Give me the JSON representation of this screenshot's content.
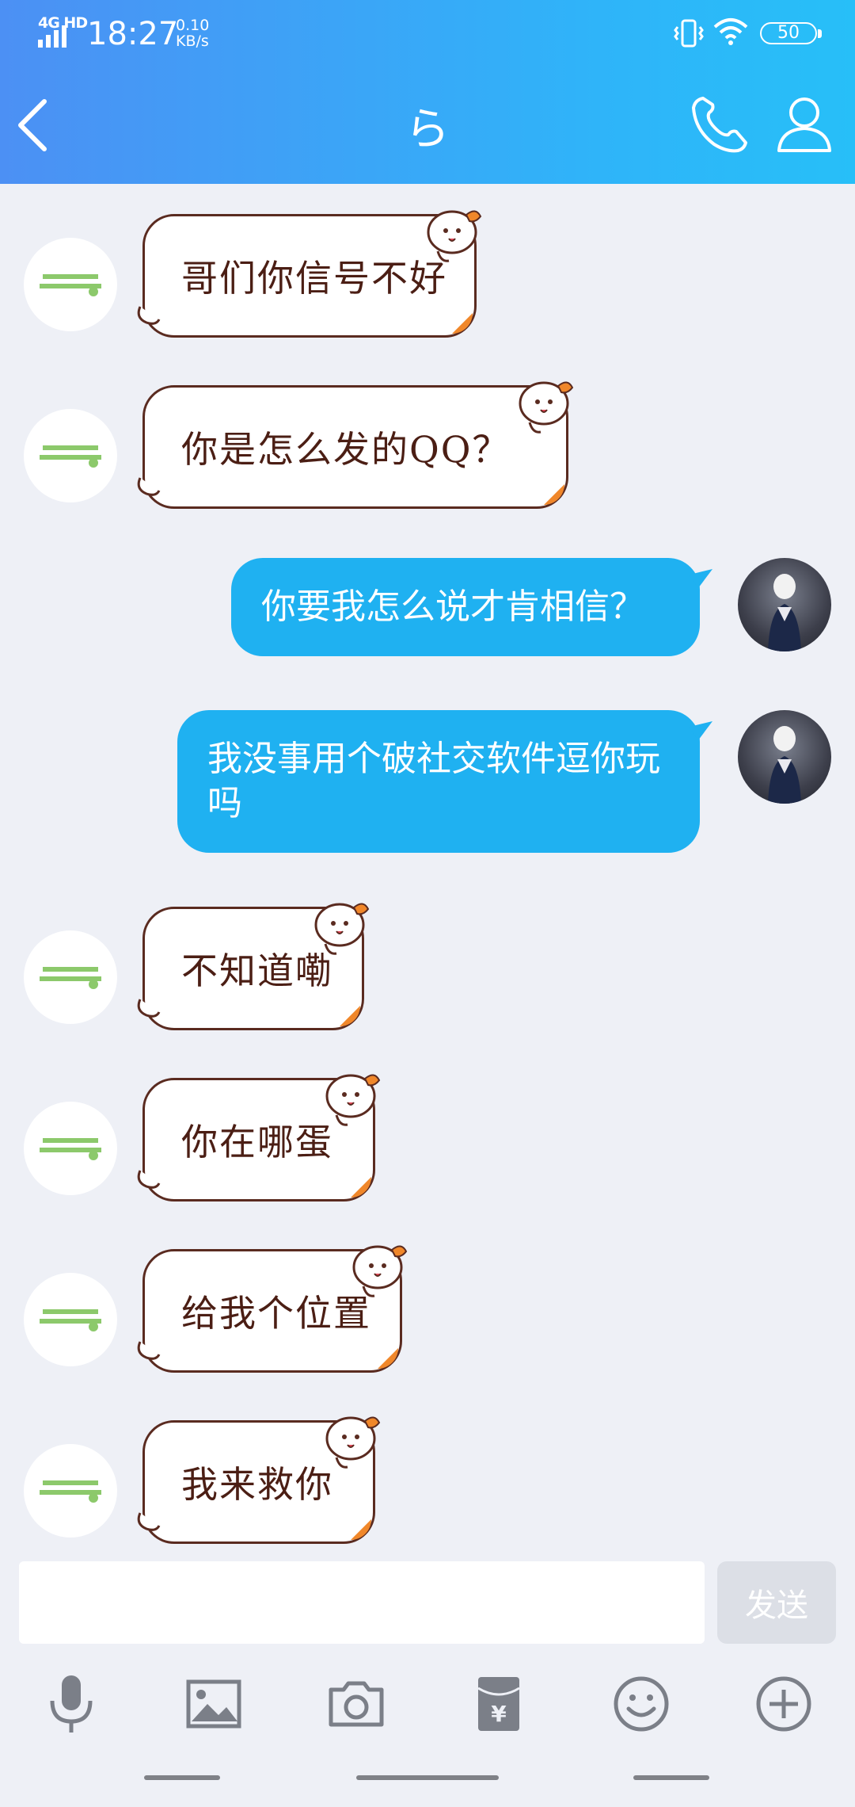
{
  "status_bar": {
    "network": "4G HD",
    "time": "18:27",
    "speed_value": "0.10",
    "speed_unit": "KB/s",
    "battery": "50"
  },
  "header": {
    "title": "ら",
    "accent_start": "#4c90f4",
    "accent_end": "#27bff8"
  },
  "messages": [
    {
      "from": "other",
      "type": "sticker",
      "text": "哥们你信号不好"
    },
    {
      "from": "other",
      "type": "sticker",
      "text": "你是怎么发的QQ？"
    },
    {
      "from": "me",
      "type": "text",
      "text": "你要我怎么说才肯相信？"
    },
    {
      "from": "me",
      "type": "text",
      "text": "我没事用个破社交软件逗你玩吗"
    },
    {
      "from": "other",
      "type": "sticker",
      "text": "不知道嘞"
    },
    {
      "from": "other",
      "type": "sticker",
      "text": "你在哪蛋"
    },
    {
      "from": "other",
      "type": "sticker",
      "text": "给我个位置"
    },
    {
      "from": "other",
      "type": "sticker",
      "text": "我来救你"
    }
  ],
  "input": {
    "value": "",
    "send_label": "发送"
  },
  "toolbar": {
    "icons": [
      "microphone-icon",
      "image-icon",
      "camera-icon",
      "red-packet-icon",
      "emoji-icon",
      "plus-icon"
    ],
    "icon_color": "#7b7f88"
  }
}
